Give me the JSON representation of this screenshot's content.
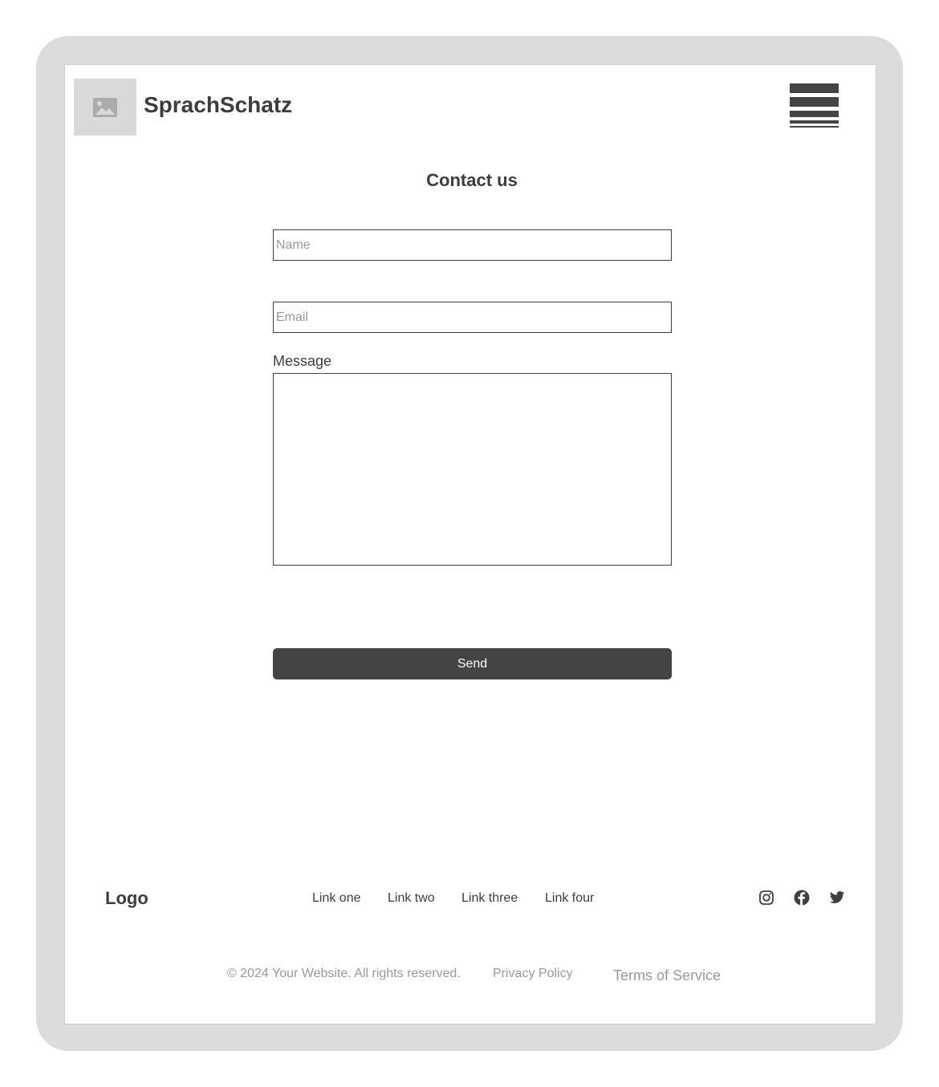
{
  "header": {
    "brand": "SprachSchatz",
    "logo_icon": "image-placeholder-icon",
    "menu_icon": "hamburger-menu-icon"
  },
  "main": {
    "title": "Contact us",
    "form": {
      "name_placeholder": "Name",
      "email_placeholder": "Email",
      "message_label": "Message",
      "send_label": "Send"
    }
  },
  "footer": {
    "logo": "Logo",
    "links": [
      "Link one",
      "Link two",
      "Link three",
      "Link four"
    ],
    "social": [
      "instagram-icon",
      "facebook-icon",
      "twitter-icon"
    ],
    "copyright": "© 2024 Your Website. All rights reserved.",
    "privacy": "Privacy Policy",
    "terms": "Terms of Service"
  },
  "colors": {
    "frame": "#dcdcdc",
    "text": "#3f3f3f",
    "button": "#444444",
    "muted": "#9a9a9a"
  }
}
